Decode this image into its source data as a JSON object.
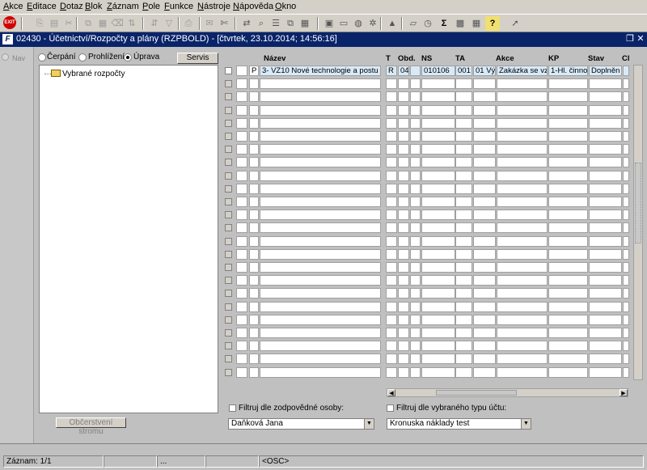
{
  "menu": [
    "Akce",
    "Editace",
    "Dotaz",
    "Blok",
    "Záznam",
    "Pole",
    "Funkce",
    "Nástroje",
    "Nápověda",
    "Okno"
  ],
  "menu_hotkeys": [
    "A",
    "E",
    "D",
    "B",
    "Z",
    "P",
    "F",
    "N",
    "N",
    "O"
  ],
  "toolbar": {
    "exit_label": "EXIT",
    "icons": [
      "save-icon",
      "print-icon",
      "cut-icon",
      "copy-icon",
      "paste-icon",
      "clear-icon",
      "sort-asc-icon",
      "sort-desc-icon",
      "filter-icon",
      "print-preview-icon",
      "mail-icon",
      "scissors-icon",
      "transfer-icon",
      "find-icon",
      "list-icon",
      "tree-icon",
      "grid-icon",
      "calc-icon",
      "doc-icon",
      "globe-icon",
      "gear-icon",
      "warning-icon",
      "chart-icon",
      "clock-icon",
      "sum-icon",
      "excel-icon",
      "calendar-icon",
      "help-icon",
      "pointer-icon"
    ],
    "sum_label": "Σ",
    "help_label": "?"
  },
  "window": {
    "icon_label": "F",
    "title": "02430 - Účetnictví/Rozpočty a plány (RZPBOLD) - [čtvrtek, 23.10.2014; 14:56:16]"
  },
  "nav": {
    "label": "Nav"
  },
  "modes": [
    {
      "label": "Čerpání",
      "selected": false
    },
    {
      "label": "Prohlížení",
      "selected": false
    },
    {
      "label": "Úprava",
      "selected": true
    }
  ],
  "servis_label": "Servis",
  "tree": {
    "root_label": "Vybrané rozpočty"
  },
  "refresh_label": "Občerstvení stromu",
  "grid": {
    "columns": [
      "Název",
      "T",
      "Obd.",
      "NS",
      "TA",
      "Akce",
      "KP",
      "Stav",
      "Cl"
    ],
    "rows": [
      {
        "flag": "P",
        "nazev": "3- VZ10 Nové technologie a postu",
        "t": "R",
        "obd": "04",
        "ns": "010106",
        "ta": "001",
        "ta2": "01 Vý",
        "akce": "Zakázka se vzo",
        "kp": "1-Hl. činnos",
        "stav": "Doplněn"
      }
    ]
  },
  "filters": {
    "person_label": "Filtruj dle zodpovědné osoby:",
    "person_value": "Daňková Jana",
    "account_label": "Filtruj dle vybraného typu účtu:",
    "account_value": "Kronuska náklady test"
  },
  "status": {
    "record": "Záznam: 1/1",
    "dots": "...",
    "mode": "<OSC>"
  }
}
